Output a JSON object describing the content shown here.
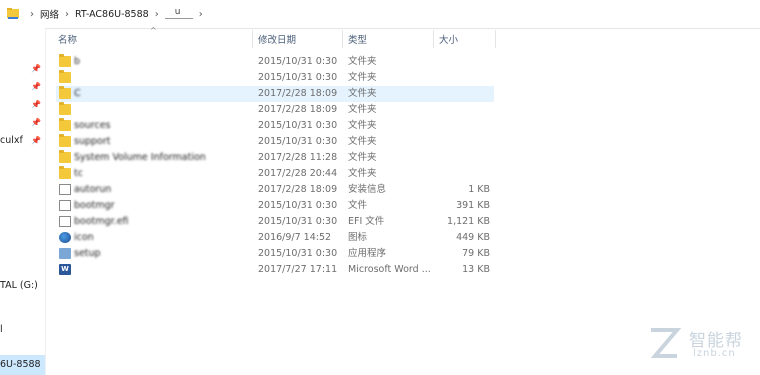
{
  "address_bar": {
    "crumbs": [
      "网络",
      "RT-AC86U-8588",
      "u"
    ]
  },
  "nav": {
    "items": [
      {
        "label": "culxf"
      },
      {
        "label": "TAL (G:)"
      },
      {
        "label": "l"
      },
      {
        "label": "6U-8588"
      }
    ]
  },
  "columns": {
    "name": "名称",
    "date": "修改日期",
    "type": "类型",
    "size": "大小"
  },
  "files": [
    {
      "icon": "folder-icon",
      "name": "b",
      "date": "2015/10/31 0:30",
      "type": "文件夹",
      "size": ""
    },
    {
      "icon": "folder-icon",
      "name": "",
      "date": "2015/10/31 0:30",
      "type": "文件夹",
      "size": ""
    },
    {
      "icon": "folder-icon",
      "name": "C",
      "date": "2017/2/28 18:09",
      "type": "文件夹",
      "size": ""
    },
    {
      "icon": "folder-icon",
      "name": "",
      "date": "2017/2/28 18:09",
      "type": "文件夹",
      "size": ""
    },
    {
      "icon": "folder-icon",
      "name": "sources",
      "date": "2015/10/31 0:30",
      "type": "文件夹",
      "size": ""
    },
    {
      "icon": "folder-icon",
      "name": "support",
      "date": "2015/10/31 0:30",
      "type": "文件夹",
      "size": ""
    },
    {
      "icon": "folder-icon",
      "name": "System Volume Information",
      "date": "2017/2/28 11:28",
      "type": "文件夹",
      "size": ""
    },
    {
      "icon": "folder-icon",
      "name": "tc",
      "date": "2017/2/28 20:44",
      "type": "文件夹",
      "size": ""
    },
    {
      "icon": "setup-info-icon",
      "name": "autorun",
      "date": "2017/2/28 18:09",
      "type": "安装信息",
      "size": "1 KB"
    },
    {
      "icon": "file-icon",
      "name": "bootmgr",
      "date": "2015/10/31 0:30",
      "type": "文件",
      "size": "391 KB"
    },
    {
      "icon": "efi-file-icon",
      "name": "bootmgr.efi",
      "date": "2015/10/31 0:30",
      "type": "EFI 文件",
      "size": "1,121 KB"
    },
    {
      "icon": "image-icon",
      "name": "icon",
      "date": "2016/9/7 14:52",
      "type": "图标",
      "size": "449 KB"
    },
    {
      "icon": "application-icon",
      "name": "setup",
      "date": "2015/10/31 0:30",
      "type": "应用程序",
      "size": "79 KB"
    },
    {
      "icon": "word-doc-icon",
      "name": "",
      "date": "2017/7/27 17:11",
      "type": "Microsoft Word ...",
      "size": "13 KB"
    }
  ],
  "watermark": {
    "cn": "智能帮",
    "en": "lznb.cn"
  },
  "colors": {
    "folder": "#f4c83b",
    "selected_row": "#e5f3ff",
    "nav_selected": "#cce8ff",
    "header_text": "#4c607a"
  }
}
